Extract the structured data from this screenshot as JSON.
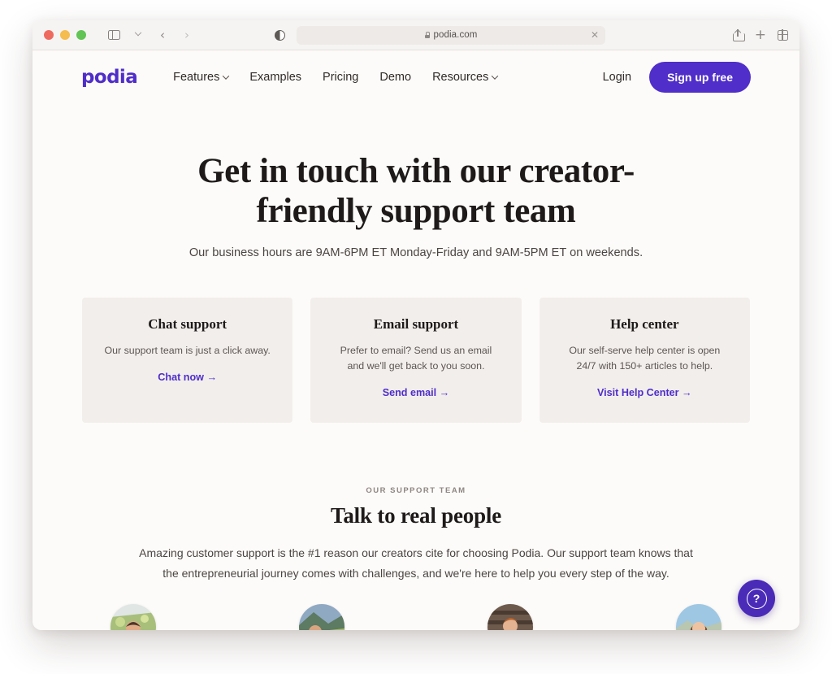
{
  "browser": {
    "window_controls": [
      "close",
      "minimize",
      "maximize"
    ],
    "sidebar_toggle_icon": "sidebar-icon",
    "back_label": "‹",
    "forward_label": "›",
    "reader_icon": "reader-mode-icon",
    "url": "podia.com",
    "url_secure_icon": "lock-icon",
    "url_clear_label": "✕",
    "share_icon": "share-icon",
    "new_tab_label": "+",
    "tab_overview_icon": "tab-grid-icon"
  },
  "nav": {
    "logo": "podia",
    "links": [
      {
        "label": "Features",
        "has_caret": true
      },
      {
        "label": "Examples",
        "has_caret": false
      },
      {
        "label": "Pricing",
        "has_caret": false
      },
      {
        "label": "Demo",
        "has_caret": false
      },
      {
        "label": "Resources",
        "has_caret": true
      }
    ],
    "login_label": "Login",
    "signup_label": "Sign up free"
  },
  "hero": {
    "heading": "Get in touch with our creator-friendly support team",
    "subheading": "Our business hours are 9AM-6PM ET Monday-Friday and 9AM-5PM ET on weekends."
  },
  "cards": [
    {
      "title": "Chat support",
      "body": "Our support team is just a click away.",
      "link": "Chat now →"
    },
    {
      "title": "Email support",
      "body": "Prefer to email? Send us an email and we'll get back to you soon.",
      "link": "Send email →"
    },
    {
      "title": "Help center",
      "body": "Our self-serve help center is open 24/7 with 150+ articles to help.",
      "link": "Visit Help Center →"
    }
  ],
  "team": {
    "eyebrow": "OUR SUPPORT TEAM",
    "heading": "Talk to real people",
    "body": "Amazing customer support is the #1 reason our creators cite for choosing Podia. Our support team knows that the entrepreneurial journey comes with challenges, and we're here to help you every step of the way."
  },
  "avatars": [
    {
      "name": "team-member-avatar-1"
    },
    {
      "name": "team-member-avatar-2"
    },
    {
      "name": "team-member-avatar-3"
    },
    {
      "name": "team-member-avatar-4"
    }
  ],
  "help_widget": {
    "icon": "question-mark-icon",
    "label": "?"
  },
  "colors": {
    "brand_purple": "#4f2ec9",
    "help_fab_purple": "#4a2bb8",
    "page_background": "#fdfbf9",
    "card_background": "#f2eeec",
    "heading_text": "#1d1a19",
    "body_text": "#4a4543"
  }
}
